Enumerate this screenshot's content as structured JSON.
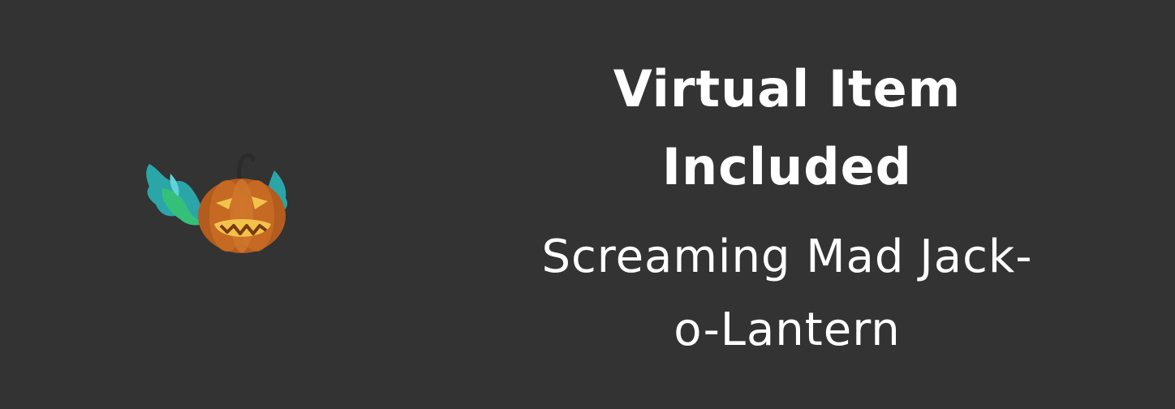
{
  "banner": {
    "title_line1": "Virtual Item",
    "title_line2": "Included",
    "item_name_line1": "Screaming Mad Jack-",
    "item_name_line2": "o-Lantern"
  },
  "colors": {
    "background": "#333333",
    "text": "#ffffff",
    "pumpkin": "#c8621a",
    "flame": "#2fb3a8"
  },
  "icons": {
    "item_thumbnail": "jack-o-lantern-icon"
  }
}
